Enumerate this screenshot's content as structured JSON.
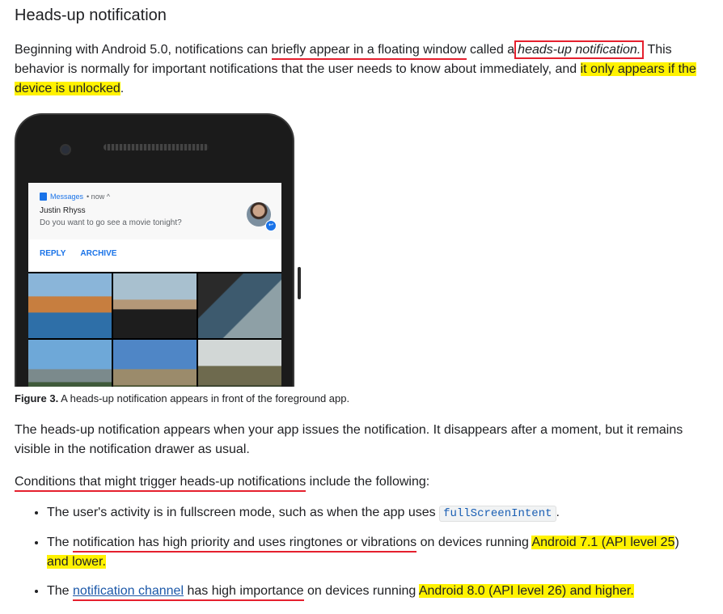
{
  "heading": "Heads-up notification",
  "intro": {
    "t1": "Beginning with Android 5.0, notifications can ",
    "t2_underlined": "briefly appear in a floating window",
    "t3": " called a",
    "t4_boxed": "heads-up notification.",
    "t5": " This behavior is normally for important notifications that the user needs to know about immediately, and ",
    "t6_highlighted": "it only appears if the device is unlocked",
    "t7": "."
  },
  "figure": {
    "notification": {
      "app_name": "Messages",
      "time": "• now ^",
      "sender": "Justin Rhyss",
      "message": "Do you want to go see a movie tonight?",
      "action_reply": "REPLY",
      "action_archive": "ARCHIVE"
    },
    "caption_label": "Figure 3.",
    "caption_text": " A heads-up notification appears in front of the foreground app."
  },
  "para2": "The heads-up notification appears when your app issues the notification. It disappears after a moment, but it remains visible in the notification drawer as usual.",
  "conditions": {
    "underlined": "Conditions that might trigger heads-up notifications",
    "rest": " include the following:"
  },
  "bullets": {
    "b1_text": "The user's activity is in fullscreen mode, such as when the app uses ",
    "b1_code": "fullScreenIntent",
    "b1_end": ".",
    "b2_pre": "The ",
    "b2_underlined": "notification has high priority and uses ringtones or vibrations",
    "b2_mid": " on devices running ",
    "b2_highlighted": "Android 7.1 (API level 25",
    "b2_after_hl": ")",
    "b2_highlighted2": "and lower.",
    "b3_pre": "The ",
    "b3_link": "notification channel",
    "b3_underlined": " has high importance",
    "b3_mid": " on devices running ",
    "b3_highlighted": "Android 8.0 (API level 26) and higher."
  }
}
